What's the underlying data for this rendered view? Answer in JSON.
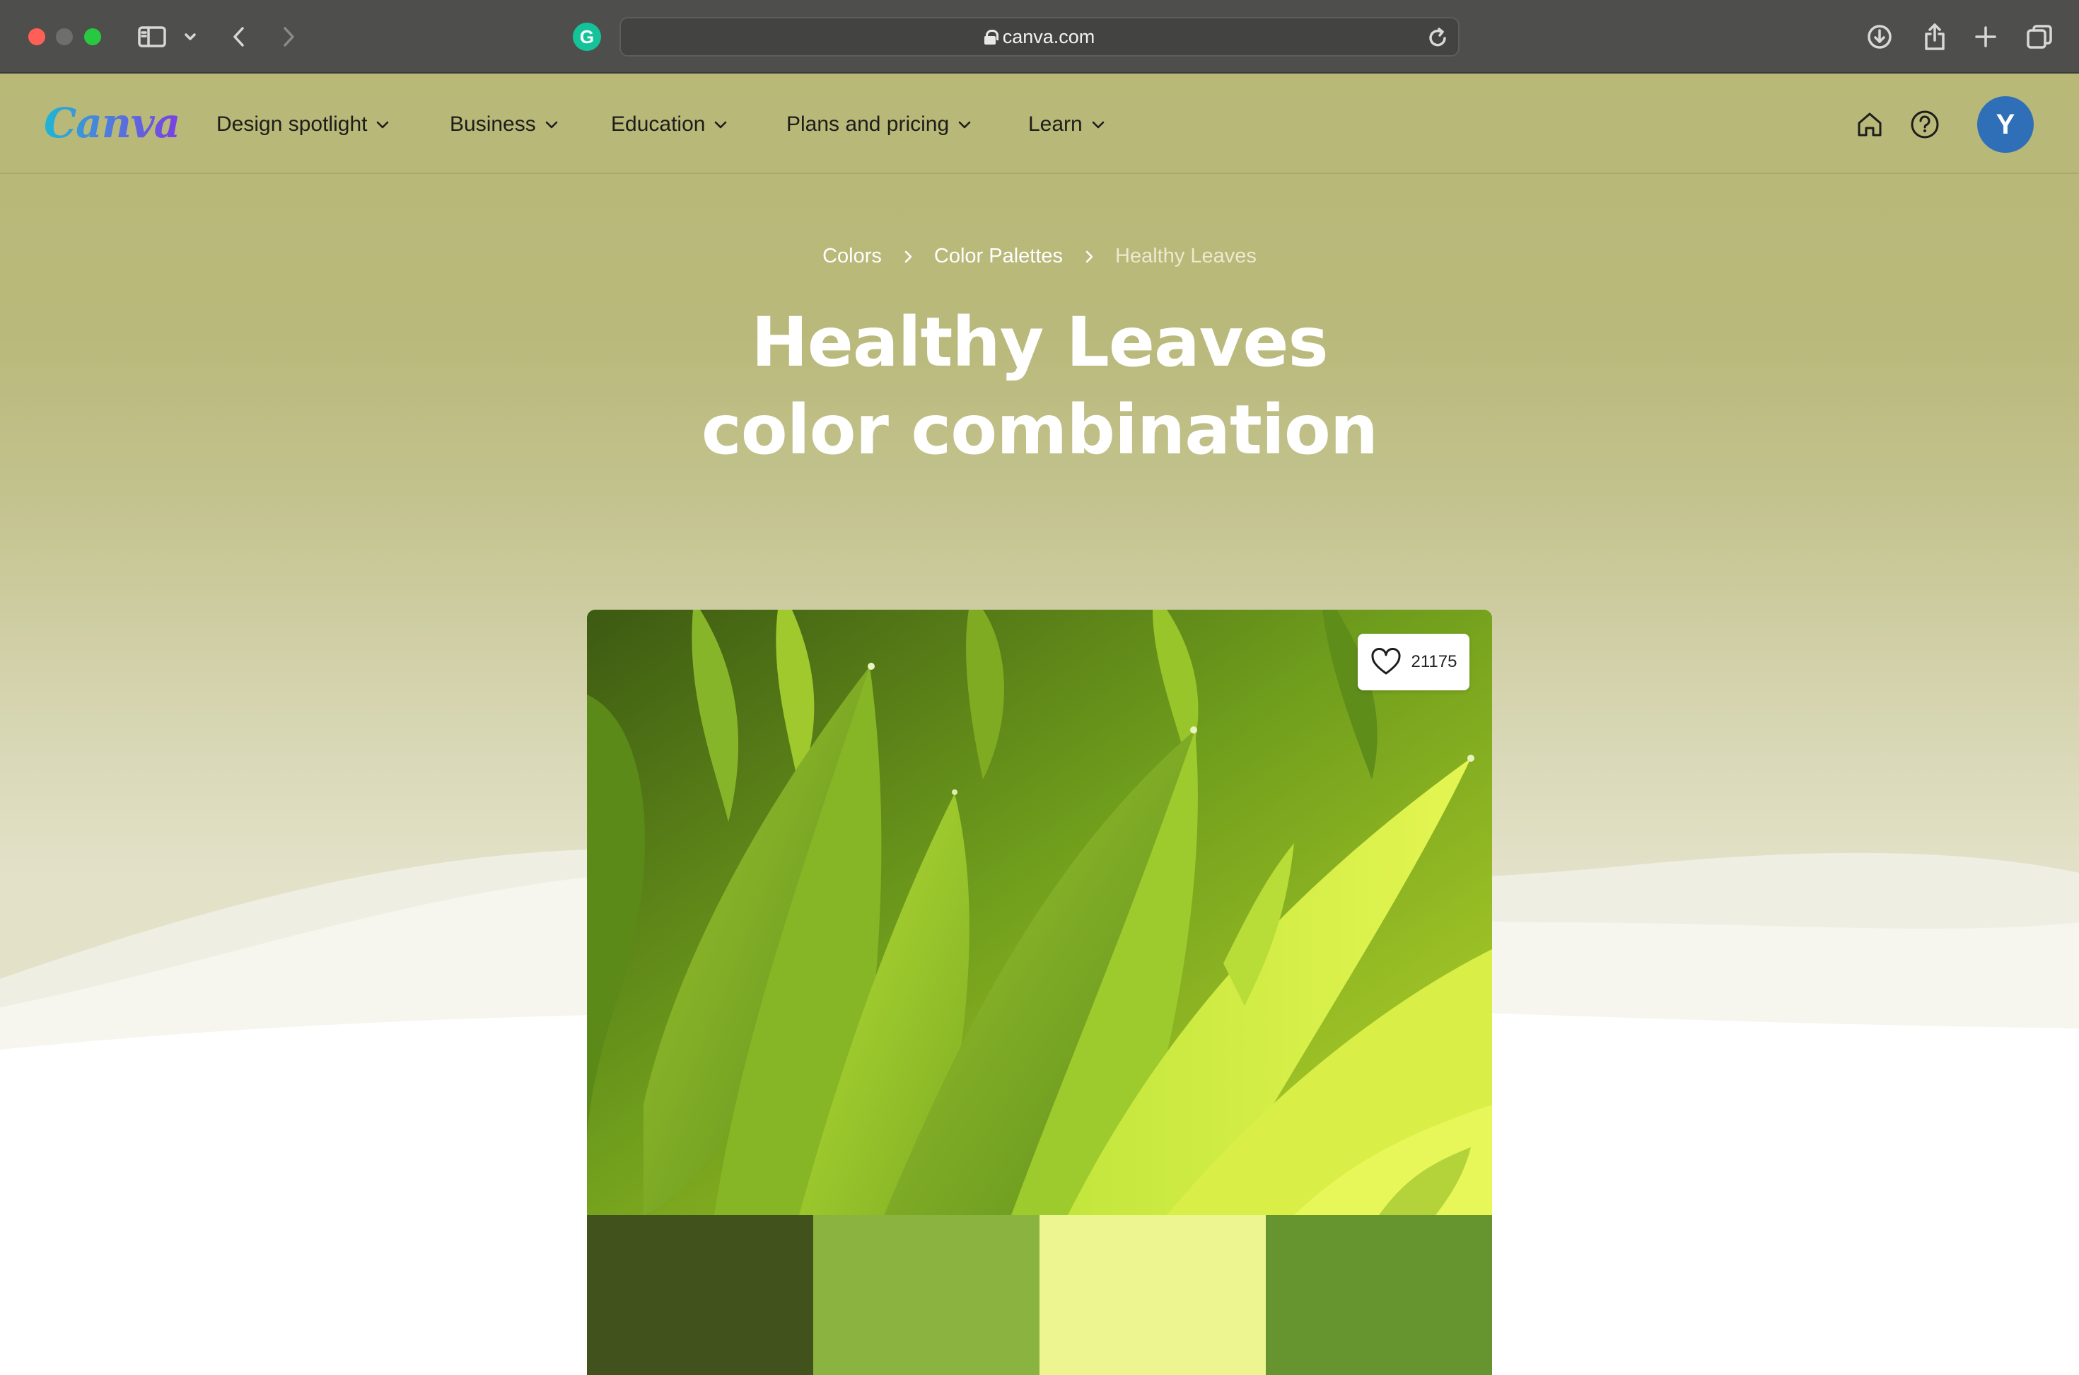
{
  "browser": {
    "url": "canva.com",
    "icons": [
      "sidebar-icon",
      "chevron-down-icon",
      "back-icon",
      "forward-icon",
      "grammarly-icon",
      "lock-icon",
      "reload-icon",
      "download-icon",
      "share-icon",
      "new-tab-icon",
      "tabs-overview-icon"
    ]
  },
  "nav": {
    "logo": "Canva",
    "items": [
      {
        "label": "Design spotlight"
      },
      {
        "label": "Business"
      },
      {
        "label": "Education"
      },
      {
        "label": "Plans and pricing"
      },
      {
        "label": "Learn"
      }
    ],
    "avatar_initial": "Y"
  },
  "breadcrumb": {
    "items": [
      "Colors",
      "Color Palettes"
    ],
    "current": "Healthy Leaves"
  },
  "heading": {
    "line1": "Healthy Leaves",
    "line2": "color combination"
  },
  "palette": {
    "likes": "21175",
    "swatches": [
      "#41521c",
      "#8bb33f",
      "#ecf590",
      "#66952f"
    ]
  },
  "colors": {
    "header_bg": "#b8b877",
    "avatar": "#2f6fb8"
  }
}
